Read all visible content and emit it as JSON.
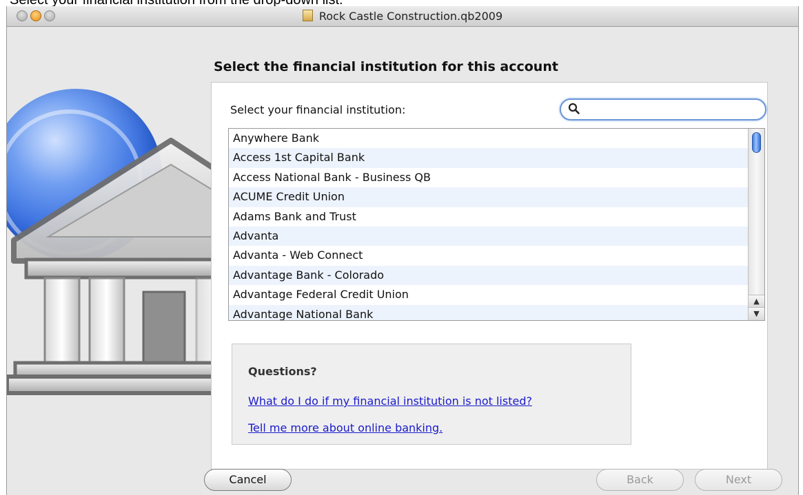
{
  "caption": "Select your financial institution from the drop-down list.",
  "window": {
    "title": "Rock Castle Construction.qb2009"
  },
  "page": {
    "heading": "Select the financial institution for this account"
  },
  "selector": {
    "label": "Select your financial institution:",
    "search_value": "",
    "items": [
      "Anywhere Bank",
      "Access 1st Capital Bank",
      "Access National Bank - Business QB",
      "ACUME Credit Union",
      "Adams Bank and Trust",
      "Advanta",
      "Advanta - Web Connect",
      "Advantage Bank - Colorado",
      "Advantage Federal Credit Union",
      "Advantage National Bank"
    ]
  },
  "questions": {
    "title": "Questions?",
    "link1": "What do I do if my financial institution is not listed?",
    "link2": "Tell me more about online banking."
  },
  "buttons": {
    "cancel": "Cancel",
    "back": "Back",
    "next": "Next"
  },
  "scroll": {
    "up_glyph": "▲",
    "down_glyph": "▼"
  }
}
